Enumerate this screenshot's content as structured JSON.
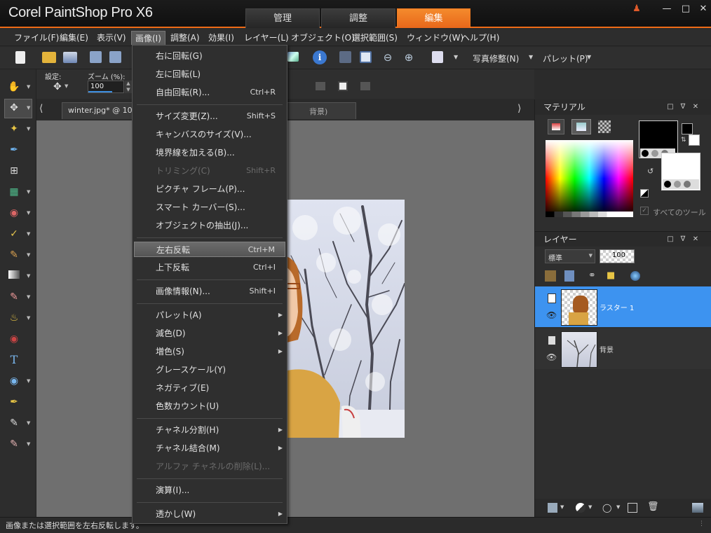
{
  "window": {
    "title": "Corel PaintShop Pro X6",
    "tabs": [
      "管理",
      "調整",
      "編集"
    ],
    "active_tab": "編集"
  },
  "menubar": [
    "ファイル(F)",
    "編集(E)",
    "表示(V)",
    "画像(I)",
    "調整(A)",
    "効果(I)",
    "レイヤー(L)",
    "オブジェクト(O)",
    "選択範囲(S)",
    "ウィンドウ(W)",
    "ヘルプ(H)"
  ],
  "toolbar": {
    "photo_fix": "写真修整(N)",
    "palette": "パレット(P)"
  },
  "tool_options": {
    "preset_label": "設定:",
    "zoom_label": "ズーム (%):",
    "zoom_value": "100"
  },
  "document": {
    "tab": "winter.jpg* @ 100",
    "tab_suffix": "背景)"
  },
  "dropdown": {
    "items": [
      {
        "label": "右に回転(G)",
        "shortcut": ""
      },
      {
        "label": "左に回転(L)",
        "shortcut": ""
      },
      {
        "label": "自由回転(R)...",
        "shortcut": "Ctrl+R"
      },
      {
        "label": "サイズ変更(Z)...",
        "shortcut": "Shift+S"
      },
      {
        "label": "キャンバスのサイズ(V)...",
        "shortcut": ""
      },
      {
        "label": "境界線を加える(B)...",
        "shortcut": ""
      },
      {
        "label": "トリミング(C)",
        "shortcut": "Shift+R"
      },
      {
        "label": "ピクチャ フレーム(P)...",
        "shortcut": ""
      },
      {
        "label": "スマート カーバー(S)...",
        "shortcut": ""
      },
      {
        "label": "オブジェクトの抽出(J)...",
        "shortcut": ""
      },
      {
        "label": "左右反転",
        "shortcut": "Ctrl+M"
      },
      {
        "label": "上下反転",
        "shortcut": "Ctrl+I"
      },
      {
        "label": "画像情報(N)...",
        "shortcut": "Shift+I"
      },
      {
        "label": "パレット(A)",
        "shortcut": ""
      },
      {
        "label": "減色(D)",
        "shortcut": ""
      },
      {
        "label": "増色(S)",
        "shortcut": ""
      },
      {
        "label": "グレースケール(Y)",
        "shortcut": ""
      },
      {
        "label": "ネガティブ(E)",
        "shortcut": ""
      },
      {
        "label": "色数カウント(U)",
        "shortcut": ""
      },
      {
        "label": "チャネル分割(H)",
        "shortcut": ""
      },
      {
        "label": "チャネル結合(M)",
        "shortcut": ""
      },
      {
        "label": "アルファ チャネルの削除(L)...",
        "shortcut": ""
      },
      {
        "label": "演算(I)...",
        "shortcut": ""
      },
      {
        "label": "透かし(W)",
        "shortcut": ""
      }
    ]
  },
  "materials": {
    "title": "マテリアル",
    "all_tools": "すべてのツール"
  },
  "layers": {
    "title": "レイヤー",
    "blend": "標準",
    "opacity": "100",
    "items": [
      "ラスター 1",
      "背景"
    ]
  },
  "status": "画像または選択範囲を左右反転します。"
}
